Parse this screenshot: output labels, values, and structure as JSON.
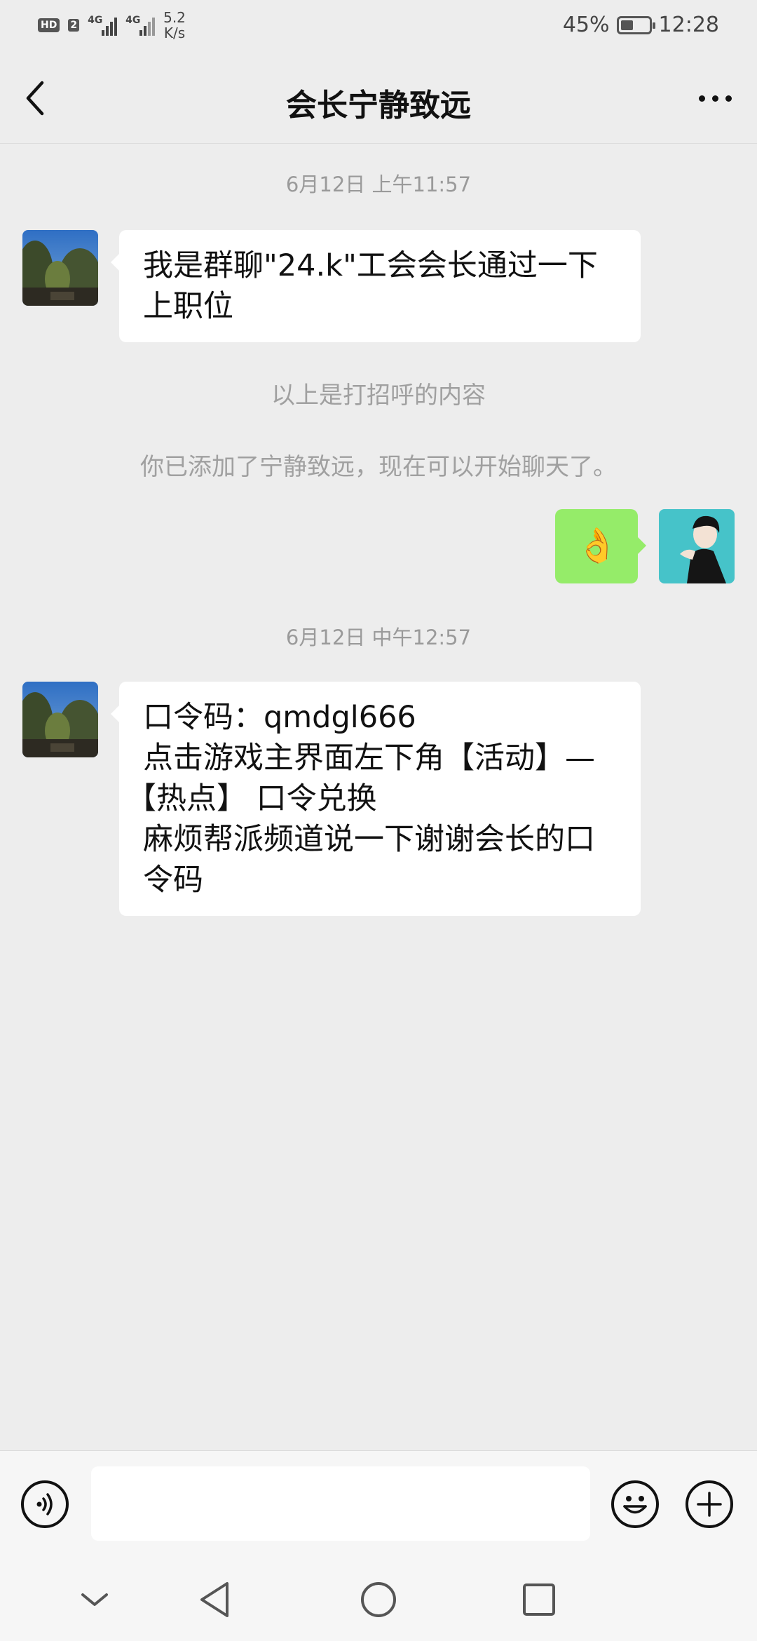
{
  "status_bar": {
    "hd_label": "HD",
    "sim_label": "2",
    "network1": "4G",
    "network2": "4G",
    "speed_value": "5.2",
    "speed_unit": "K/s",
    "battery_text": "45%",
    "battery_level": 0.45,
    "time": "12:28"
  },
  "header": {
    "title": "会长宁静致远"
  },
  "messages": {
    "time1": "6月12日 上午11:57",
    "msg1_lines": [
      "我是群聊\"24.k\"工会会长通过一下",
      "上职位"
    ],
    "sys1": "以上是打招呼的内容",
    "sys2": "你已添加了宁静致远，现在可以开始聊天了。",
    "sent_emoji": "👌",
    "time2": "6月12日 中午12:57",
    "msg2_lines": [
      "口令码：qmdgl666",
      "点击游戏主界面左下角【活动】—",
      "【热点】 口令兑换",
      "麻烦帮派频道说一下谢谢会长的口",
      "令码"
    ]
  },
  "input": {
    "placeholder": ""
  },
  "icons": {
    "back": "chevron-left-icon",
    "more": "more-icon",
    "voice": "voice-icon",
    "emoji": "emoji-icon",
    "add": "plus-icon"
  },
  "colors": {
    "background": "#ededed",
    "sent_bubble": "#95ec69",
    "received_bubble": "#ffffff"
  }
}
